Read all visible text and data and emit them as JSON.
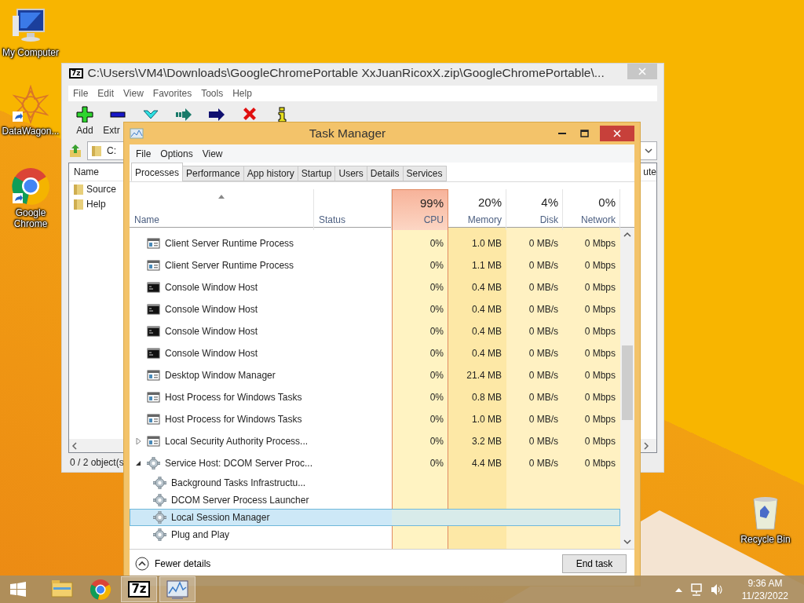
{
  "desktop_icons": [
    {
      "label": "My Computer",
      "shortcut": false
    },
    {
      "label": "DataWagon...",
      "shortcut": true
    },
    {
      "label": "Google Chrome",
      "shortcut": true
    },
    {
      "label": "Recycle Bin",
      "shortcut": false
    }
  ],
  "archive_window": {
    "logo_text": "7z",
    "title": "C:\\Users\\VM4\\Downloads\\GoogleChromePortable XxJuanRicoxX.zip\\GoogleChromePortable\\...",
    "menu": [
      "File",
      "Edit",
      "View",
      "Favorites",
      "Tools",
      "Help"
    ],
    "toolbar_labels": [
      "Add",
      "Extr"
    ],
    "address": "C:",
    "columns": [
      "Name"
    ],
    "items": [
      "Source",
      "Help"
    ],
    "column_fragment": "ute",
    "status": "0 / 2 object(s"
  },
  "task_manager": {
    "title": "Task Manager",
    "menu": [
      "File",
      "Options",
      "View"
    ],
    "tabs": [
      {
        "label": "Processes",
        "selected": true
      },
      {
        "label": "Performance",
        "selected": false
      },
      {
        "label": "App history",
        "selected": false
      },
      {
        "label": "Startup",
        "selected": false
      },
      {
        "label": "Users",
        "selected": false
      },
      {
        "label": "Details",
        "selected": false
      },
      {
        "label": "Services",
        "selected": false
      }
    ],
    "columns": [
      {
        "label": "Name",
        "sorted": true
      },
      {
        "label": "Status",
        "sorted": false
      },
      {
        "label": "CPU",
        "reading": "99%",
        "sorted": false
      },
      {
        "label": "Memory",
        "reading": "20%",
        "sorted": false
      },
      {
        "label": "Disk",
        "reading": "4%",
        "sorted": false
      },
      {
        "label": "Network",
        "reading": "0%",
        "sorted": false
      }
    ],
    "rows": [
      {
        "kind": "window",
        "name": "Client Server Runtime Process",
        "cpu": "0%",
        "memory": "1.0 MB",
        "disk": "0 MB/s",
        "network": "0 Mbps",
        "selected": false
      },
      {
        "kind": "window",
        "name": "Client Server Runtime Process",
        "cpu": "0%",
        "memory": "1.1 MB",
        "disk": "0 MB/s",
        "network": "0 Mbps",
        "selected": false
      },
      {
        "kind": "console",
        "name": "Console Window Host",
        "cpu": "0%",
        "memory": "0.4 MB",
        "disk": "0 MB/s",
        "network": "0 Mbps",
        "selected": false
      },
      {
        "kind": "console",
        "name": "Console Window Host",
        "cpu": "0%",
        "memory": "0.4 MB",
        "disk": "0 MB/s",
        "network": "0 Mbps",
        "selected": false
      },
      {
        "kind": "console",
        "name": "Console Window Host",
        "cpu": "0%",
        "memory": "0.4 MB",
        "disk": "0 MB/s",
        "network": "0 Mbps",
        "selected": false
      },
      {
        "kind": "console",
        "name": "Console Window Host",
        "cpu": "0%",
        "memory": "0.4 MB",
        "disk": "0 MB/s",
        "network": "0 Mbps",
        "selected": false
      },
      {
        "kind": "window",
        "name": "Desktop Window Manager",
        "cpu": "0%",
        "memory": "21.4 MB",
        "disk": "0 MB/s",
        "network": "0 Mbps",
        "selected": false
      },
      {
        "kind": "window",
        "name": "Host Process for Windows Tasks",
        "cpu": "0%",
        "memory": "0.8 MB",
        "disk": "0 MB/s",
        "network": "0 Mbps",
        "selected": false
      },
      {
        "kind": "window",
        "name": "Host Process for Windows Tasks",
        "cpu": "0%",
        "memory": "1.0 MB",
        "disk": "0 MB/s",
        "network": "0 Mbps",
        "selected": false
      },
      {
        "kind": "window",
        "expanded": false,
        "name": "Local Security Authority Process...",
        "cpu": "0%",
        "memory": "3.2 MB",
        "disk": "0 MB/s",
        "network": "0 Mbps",
        "selected": false
      },
      {
        "kind": "service",
        "expanded": true,
        "name": "Service Host: DCOM Server Proc...",
        "cpu": "0%",
        "memory": "4.4 MB",
        "disk": "0 MB/s",
        "network": "0 Mbps",
        "selected": false,
        "children": [
          {
            "kind": "service",
            "name": "Background Tasks Infrastructu...",
            "selected": false
          },
          {
            "kind": "service",
            "name": "DCOM Server Process Launcher",
            "selected": false
          },
          {
            "kind": "service",
            "name": "Local Session Manager",
            "selected": true
          },
          {
            "kind": "service",
            "name": "Plug and Play",
            "selected": false
          }
        ]
      }
    ],
    "fewer_details": "Fewer details",
    "end_task": "End task"
  },
  "taskbar": {
    "apps": [
      {
        "active": false
      },
      {
        "active": false
      },
      {
        "logo_text": "7z",
        "active": true
      },
      {
        "active": true
      }
    ],
    "time": "9:36 AM",
    "date": "11/23/2022"
  }
}
